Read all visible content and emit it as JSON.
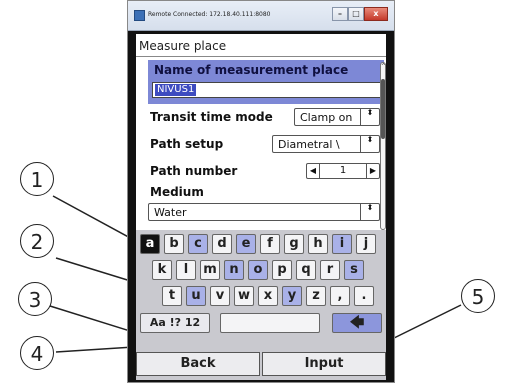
{
  "window": {
    "title": "Remote Connected: 172.18.40.111:8080",
    "minimize_symbol": "–",
    "maximize_symbol": "□",
    "close_symbol": "x"
  },
  "screen": {
    "title": "Measure place",
    "name_label": "Name of measurement place",
    "name_value": "NIVUS1",
    "rows": {
      "transit_label": "Transit time mode",
      "transit_value": "Clamp on",
      "path_setup_label": "Path setup",
      "path_setup_value": "Diametral \\",
      "path_number_label": "Path number",
      "path_number_value": "1",
      "medium_label": "Medium",
      "medium_value": "Water"
    },
    "dropdown_arrow": "⬍",
    "stepper_left": "◀",
    "stepper_right": "▶"
  },
  "keyboard": {
    "row1": [
      "a",
      "b",
      "c",
      "d",
      "e",
      "f",
      "g",
      "h",
      "i",
      "j"
    ],
    "row2": [
      "k",
      "l",
      "m",
      "n",
      "o",
      "p",
      "q",
      "r",
      "s"
    ],
    "row3": [
      "t",
      "u",
      "v",
      "w",
      "x",
      "y",
      "z",
      ",",
      "."
    ],
    "mode_label": "Aa !? 12",
    "space_label": "",
    "backspace_label": "🡄",
    "back_label": "Back",
    "input_label": "Input"
  },
  "callouts": [
    "1",
    "2",
    "3",
    "4",
    "5"
  ],
  "colors": {
    "selection": "#7d88d6",
    "key_blue": "#a9b1e8",
    "key_active": "#111111"
  }
}
